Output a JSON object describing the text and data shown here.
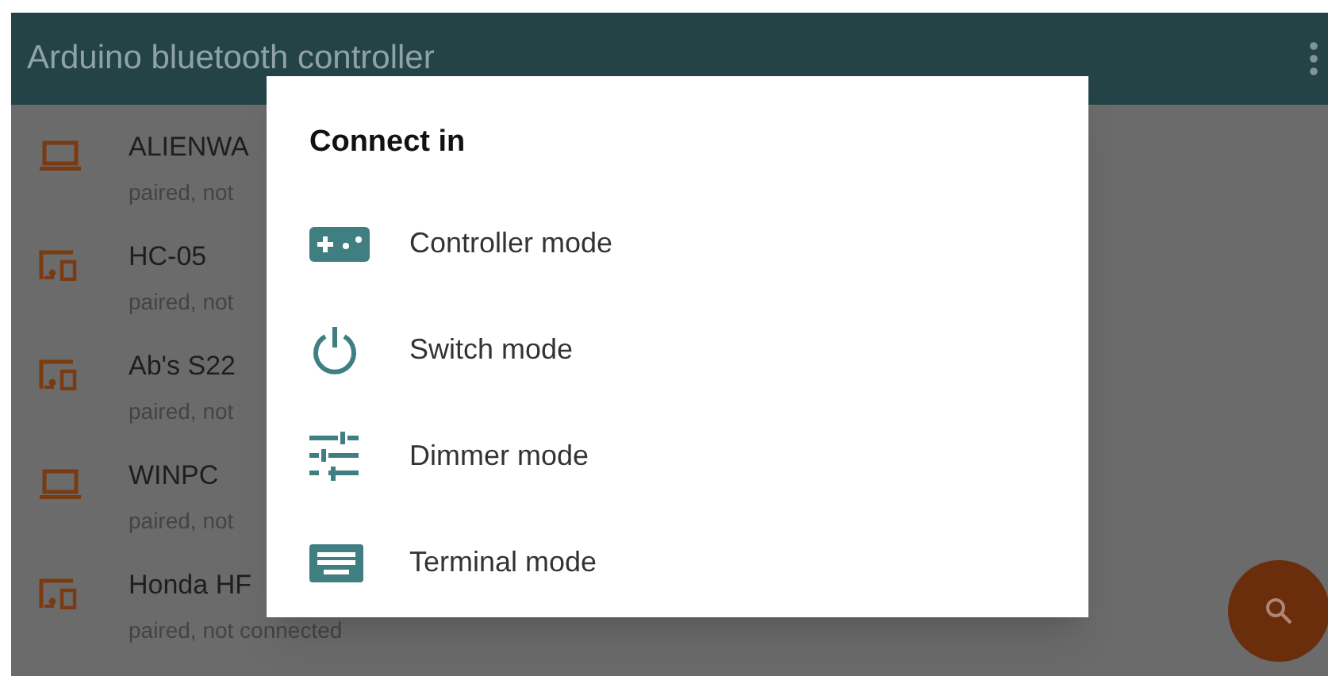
{
  "app_bar": {
    "title": "Arduino bluetooth controller"
  },
  "devices": [
    {
      "kind": "laptop",
      "name": "ALIENWA",
      "status": "paired, not"
    },
    {
      "kind": "device",
      "name": "HC-05",
      "status": "paired, not"
    },
    {
      "kind": "device",
      "name": "Ab's S22",
      "status": "paired, not"
    },
    {
      "kind": "laptop",
      "name": "WINPC",
      "status": "paired, not"
    },
    {
      "kind": "device",
      "name": "Honda HF",
      "status": "paired, not connected"
    }
  ],
  "dialog": {
    "title": "Connect in",
    "options": [
      {
        "kind": "controller",
        "label": "Controller mode"
      },
      {
        "kind": "switch",
        "label": "Switch mode"
      },
      {
        "kind": "dimmer",
        "label": "Dimmer mode"
      },
      {
        "kind": "terminal",
        "label": "Terminal mode"
      }
    ]
  }
}
